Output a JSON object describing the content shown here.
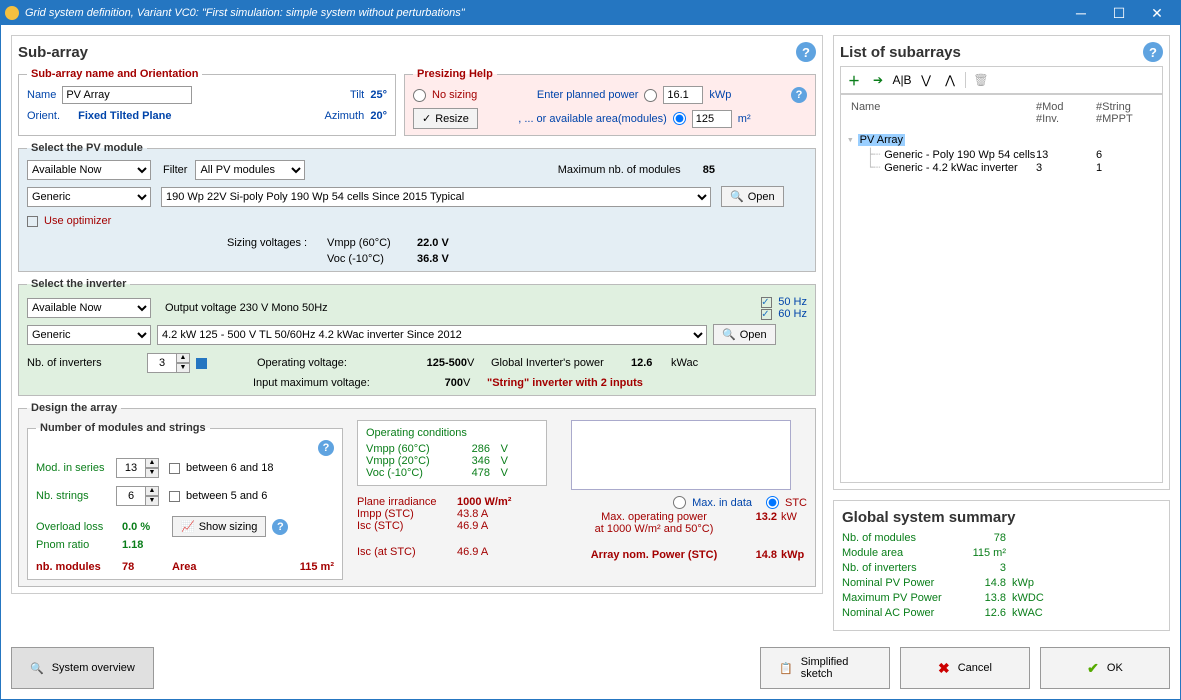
{
  "titlebar": "Grid system definition, Variant VC0:   \"First simulation: simple system without perturbations\"",
  "subarray": {
    "title": "Sub-array",
    "orient_legend": "Sub-array name and Orientation",
    "name_label": "Name",
    "name_value": "PV Array",
    "orient_label": "Orient.",
    "orient_mode": "Fixed Tilted Plane",
    "tilt_label": "Tilt",
    "tilt_val": "25°",
    "azimuth_label": "Azimuth",
    "azimuth_val": "20°",
    "presizing_legend": "Presizing Help",
    "no_sizing": "No sizing",
    "enter_power": "Enter planned power",
    "planned_power_val": "16.1",
    "planned_power_unit": "kWp",
    "or_area": ",  ... or available area(modules)",
    "area_val": "125",
    "area_unit": "m²",
    "resize": "Resize"
  },
  "pv": {
    "legend": "Select the PV module",
    "avail": "Available Now",
    "filter_label": "Filter",
    "filter_val": "All PV modules",
    "max_mod_label": "Maximum nb. of modules",
    "max_mod_val": "85",
    "manuf": "Generic",
    "module_desc": "190 Wp 22V         Si-poly              Poly 190 Wp  54 cells              Since 2015                      Typical",
    "open": "Open",
    "use_opt": "Use optimizer",
    "sv_label": "Sizing voltages :",
    "vmpp60_label": "Vmpp (60°C)",
    "vmpp60_val": "22.0 V",
    "voc_label": "Voc (-10°C)",
    "voc_val": "36.8 V"
  },
  "inv": {
    "legend": "Select the inverter",
    "avail": "Available Now",
    "output": "Output voltage 230 V Mono 50Hz",
    "hz50": "50 Hz",
    "hz60": "60 Hz",
    "manuf": "Generic",
    "inv_desc": "4.2 kW     125 - 500 V   TL       50/60Hz      4.2 kWac inverter                                               Since 2012",
    "open": "Open",
    "nb_inv_label": "Nb. of inverters",
    "nb_inv_val": "3",
    "op_volt_label": "Operating voltage:",
    "op_volt_val": "125-500",
    "v": "V",
    "global_inv_label": "Global Inverter's power",
    "global_inv_val": "12.6",
    "global_inv_unit": "kWac",
    "max_volt_label": "Input maximum voltage:",
    "max_volt_val": "700",
    "string_note": "\"String\" inverter with 2 inputs"
  },
  "design": {
    "legend": "Design the array",
    "num_legend": "Number of modules and strings",
    "mod_series_label": "Mod. in series",
    "mod_series_val": "13",
    "mod_series_hint": "between 6 and 18",
    "nb_strings_label": "Nb. strings",
    "nb_strings_val": "6",
    "nb_strings_hint": "between 5 and 6",
    "overload_label": "Overload loss",
    "overload_val": "0.0 %",
    "pnom_label": "Pnom ratio",
    "pnom_val": "1.18",
    "show_sizing": "Show sizing",
    "nb_modules_label": "nb. modules",
    "nb_modules_val": "78",
    "area_label": "Area",
    "area_val": "115 m²",
    "opcond": "Operating conditions",
    "vmpp60l": "Vmpp (60°C)",
    "vmpp60v": "286",
    "vu": "V",
    "vmpp20l": "Vmpp (20°C)",
    "vmpp20v": "346",
    "vocm10l": "Voc (-10°C)",
    "vocm10v": "478",
    "plane_irr_label": "Plane irradiance",
    "plane_irr_val": "1000 W/m²",
    "impp_label": "Impp (STC)",
    "impp_val": "43.8 A",
    "isc_label": "Isc (STC)",
    "isc_val": "46.9 A",
    "isc_at_label": "Isc (at STC)",
    "isc_at_val": "46.9 A",
    "max_in_data": "Max. in data",
    "stc": "STC",
    "max_op_power_label": "Max. operating power",
    "max_op_power_val": "13.2",
    "max_op_power_unit": "kW",
    "max_op_cond": "at 1000 W/m²  and 50°C)",
    "array_nom_label": "Array nom. Power (STC)",
    "array_nom_val": "14.8",
    "array_nom_unit": "kWp"
  },
  "list": {
    "title": "List of subarrays",
    "hdr_name": "Name",
    "hdr_mod": "#Mod\n#Inv.",
    "hdr_string": "#String\n#MPPT",
    "root": "PV Array",
    "row1_label": "Generic - Poly 190 Wp  54 cells",
    "row1_mod": "13",
    "row1_str": "6",
    "row2_label": "Generic - 4.2 kWac inverter",
    "row2_mod": "3",
    "row2_str": "1"
  },
  "summary": {
    "title": "Global system summary",
    "nb_mod": "Nb. of modules",
    "nb_mod_v": "78",
    "mod_area": "Module area",
    "mod_area_v": "115 m²",
    "nb_inv": "Nb. of inverters",
    "nb_inv_v": "3",
    "nom_pv": "Nominal PV Power",
    "nom_pv_v": "14.8",
    "nom_pv_u": "kWp",
    "max_pv": "Maximum PV Power",
    "max_pv_v": "13.8",
    "max_pv_u": "kWDC",
    "nom_ac": "Nominal AC Power",
    "nom_ac_v": "12.6",
    "nom_ac_u": "kWAC"
  },
  "footer": {
    "overview": "System overview",
    "sketch": "Simplified sketch",
    "cancel": "Cancel",
    "ok": "OK"
  }
}
